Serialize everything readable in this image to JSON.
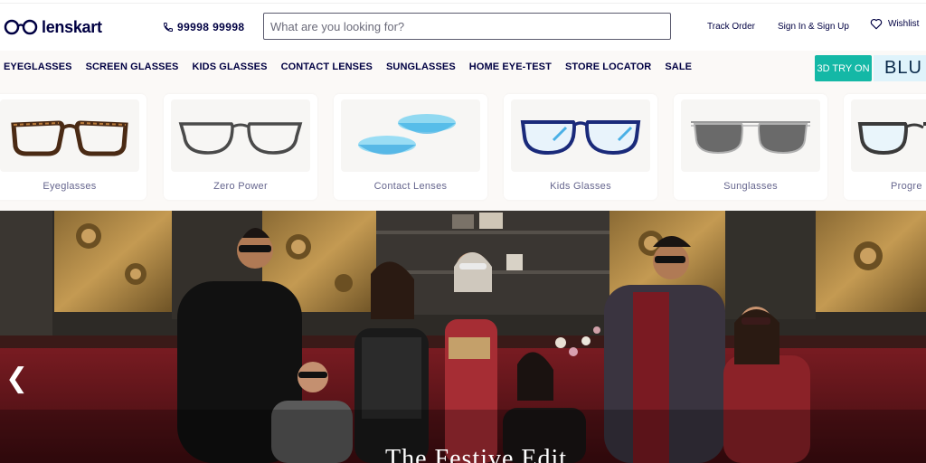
{
  "brand": {
    "name": "lenskart"
  },
  "header": {
    "phone": "99998 99998",
    "search_placeholder": "What are you looking for?",
    "track_order": "Track Order",
    "sign_in": "Sign In & Sign Up",
    "wishlist": "Wishlist"
  },
  "nav": {
    "items": [
      "EYEGLASSES",
      "SCREEN GLASSES",
      "KIDS GLASSES",
      "CONTACT LENSES",
      "SUNGLASSES",
      "HOME EYE-TEST",
      "STORE LOCATOR",
      "SALE"
    ],
    "try3d": "3D TRY ON",
    "blu": "BLU"
  },
  "categories": [
    {
      "label": "Eyeglasses"
    },
    {
      "label": "Zero Power"
    },
    {
      "label": "Contact Lenses"
    },
    {
      "label": "Kids Glasses"
    },
    {
      "label": "Sunglasses"
    },
    {
      "label": "Progre"
    }
  ],
  "hero": {
    "title": "The Festive Edit",
    "prev_glyph": "❮"
  },
  "colors": {
    "brand_navy": "#000042",
    "teal": "#14b8a6",
    "hero_maroon": "#6b1a1f"
  }
}
